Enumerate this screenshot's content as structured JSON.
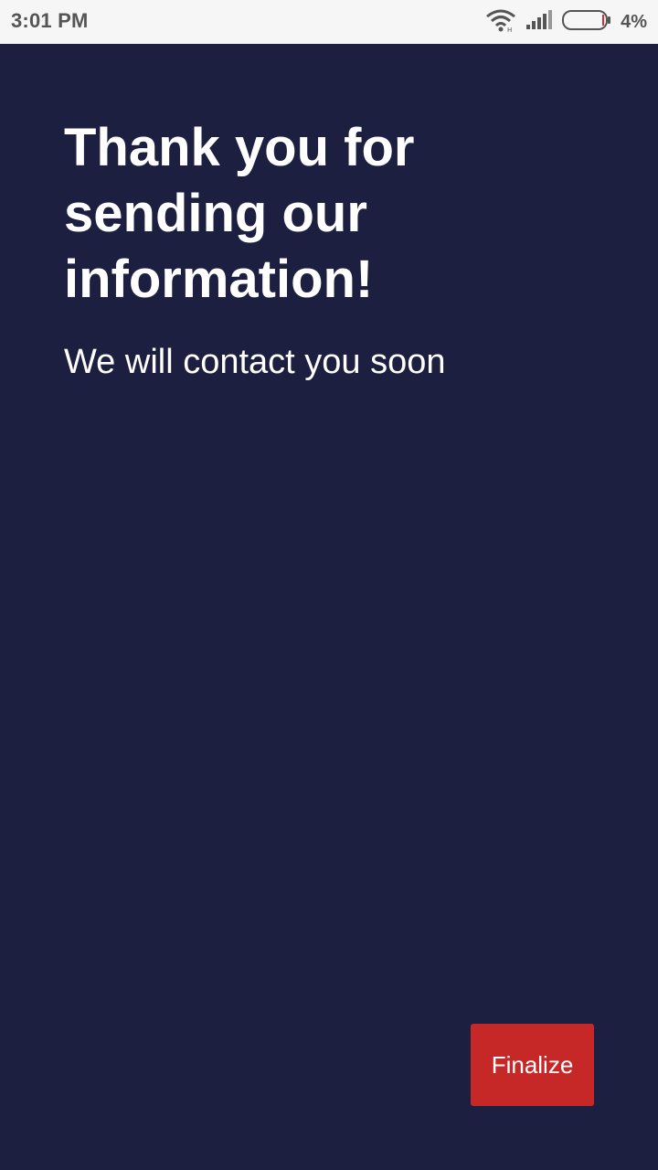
{
  "status_bar": {
    "time": "3:01 PM",
    "battery_percent": "4%",
    "icons": [
      "wifi-icon",
      "signal-icon",
      "battery-icon"
    ]
  },
  "main": {
    "title": "Thank you for sending our information!",
    "subtitle": "We will contact you soon"
  },
  "actions": {
    "finalize_label": "Finalize"
  },
  "colors": {
    "background": "#1c1f3f",
    "status_bar_bg": "#f6f6f6",
    "button": "#c62828",
    "text": "#ffffff"
  }
}
